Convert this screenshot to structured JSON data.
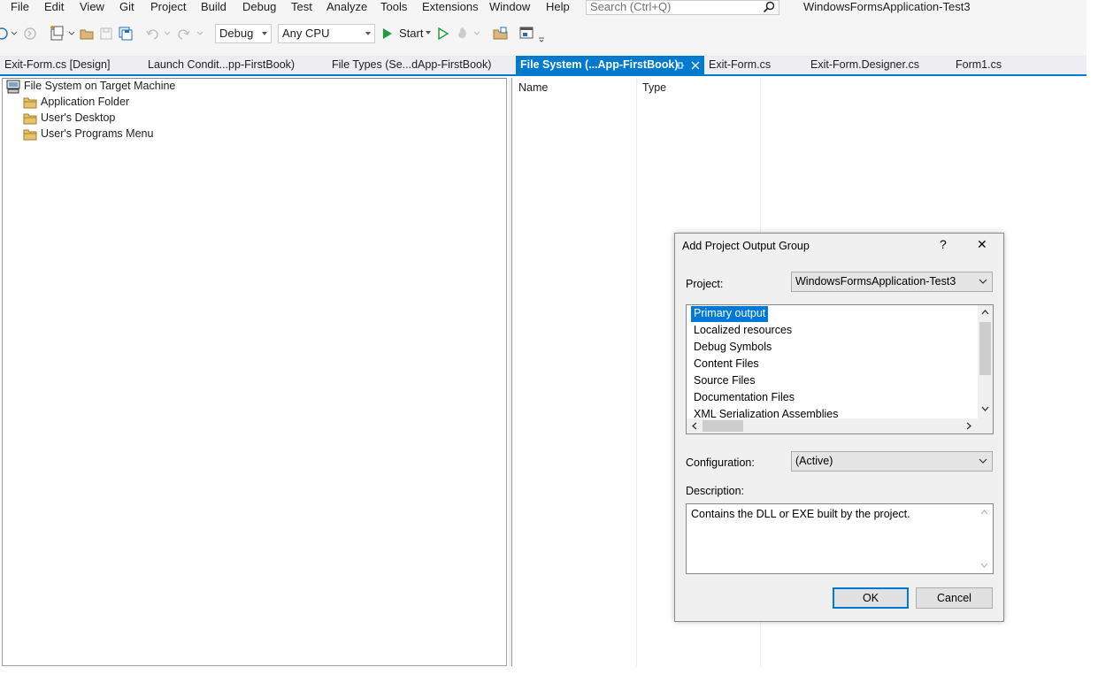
{
  "menu": [
    "File",
    "Edit",
    "View",
    "Git",
    "Project",
    "Build",
    "Debug",
    "Test",
    "Analyze",
    "Tools",
    "Extensions",
    "Window",
    "Help"
  ],
  "search": {
    "placeholder": "Search (Ctrl+Q)"
  },
  "app_title": "WindowsFormsApplication-Test3",
  "toolbar": {
    "configuration": "Debug",
    "platform": "Any CPU",
    "start_label": "Start"
  },
  "tabs": [
    {
      "label": "Exit-Form.cs [Design]",
      "active": false
    },
    {
      "label": "Launch Condit...pp-FirstBook)",
      "active": false
    },
    {
      "label": "File Types (Se...dApp-FirstBook)",
      "active": false
    },
    {
      "label": "File System (...App-FirstBook)",
      "active": true
    },
    {
      "label": "Exit-Form.cs",
      "active": false
    },
    {
      "label": "Exit-Form.Designer.cs",
      "active": false
    },
    {
      "label": "Form1.cs",
      "active": false
    }
  ],
  "tree": {
    "root": "File System on Target Machine",
    "items": [
      "Application Folder",
      "User's Desktop",
      "User's Programs Menu"
    ]
  },
  "list_columns": [
    "Name",
    "Type"
  ],
  "dialog": {
    "title": "Add Project Output Group",
    "help_glyph": "?",
    "close_glyph": "✕",
    "project_label": "Project:",
    "project_value": "WindowsFormsApplication-Test3",
    "outputs": [
      "Primary output",
      "Localized resources",
      "Debug Symbols",
      "Content Files",
      "Source Files",
      "Documentation Files",
      "XML Serialization Assemblies"
    ],
    "selected_output": "Primary output",
    "configuration_label": "Configuration:",
    "configuration_value": "(Active)",
    "description_label": "Description:",
    "description_text": "Contains the DLL or EXE built by the project.",
    "ok_label": "OK",
    "cancel_label": "Cancel"
  },
  "colors": {
    "accent": "#007acc",
    "selection": "#0078d7"
  }
}
